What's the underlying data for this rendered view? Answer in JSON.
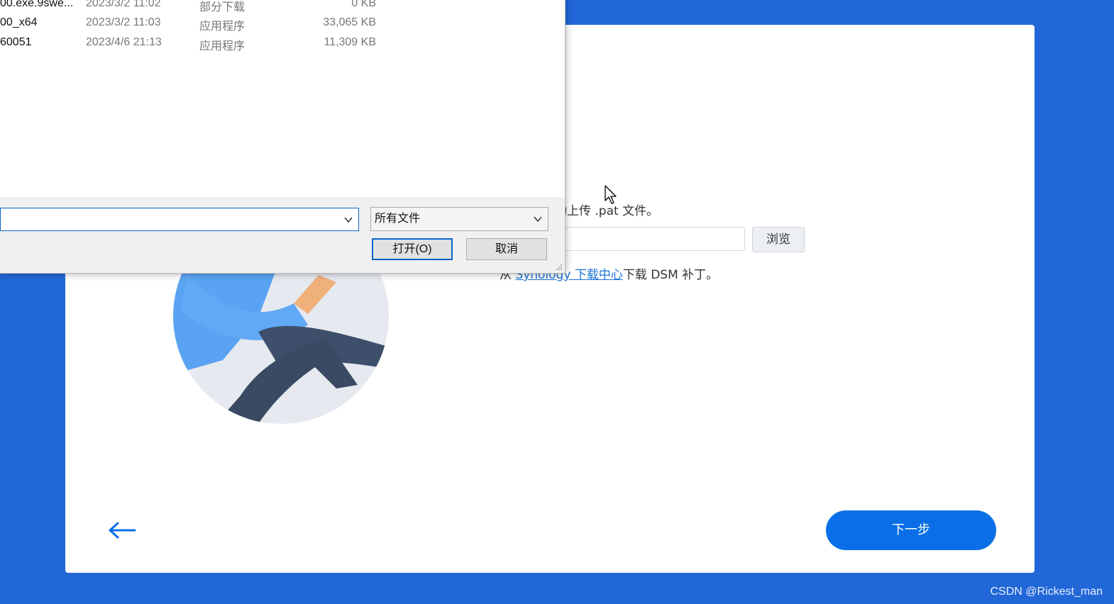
{
  "file_dialog": {
    "files": [
      {
        "name": "00.exe.9swe...",
        "date": "2023/3/2 11:02",
        "type": "部分下载",
        "size": "0 KB"
      },
      {
        "name": "00_x64",
        "date": "2023/3/2 11:03",
        "type": "应用程序",
        "size": "33,065 KB"
      },
      {
        "name": "60051",
        "date": "2023/4/6 21:13",
        "type": "应用程序",
        "size": "11,309 KB"
      }
    ],
    "filename_value": "",
    "file_type_filter": "所有文件",
    "open_button": "打开(O)",
    "cancel_button": "取消"
  },
  "wizard": {
    "instruction": "动上传 .pat 文件。",
    "browse_button": "浏览",
    "download_prefix": "从 ",
    "download_link": "Synology 下载中心",
    "download_suffix": "下载 DSM 补丁。",
    "next_button": "下一步"
  },
  "watermark": "CSDN @Rickest_man",
  "colors": {
    "background": "#2167d8",
    "accent": "#0a6fe6",
    "link": "#1a73d9"
  }
}
